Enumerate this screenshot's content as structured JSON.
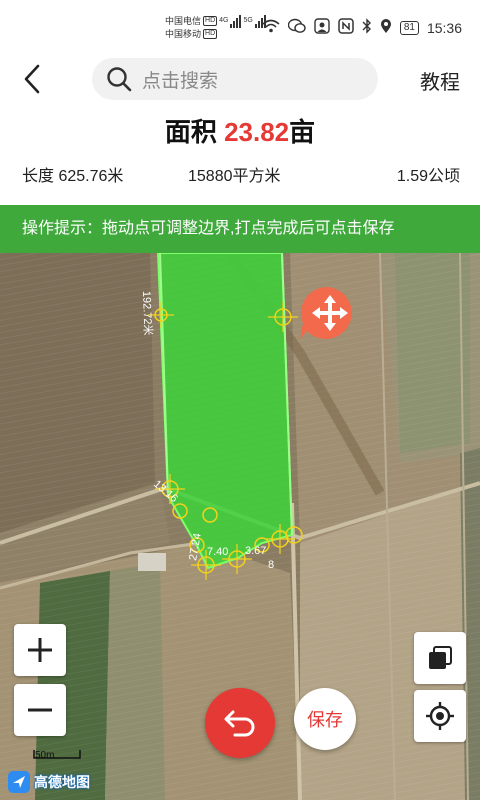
{
  "status_bar": {
    "carrier1": "中国电信",
    "carrier2": "中国移动",
    "hd": "HD",
    "net1": "4G",
    "net2": "5G",
    "battery": "81",
    "time": "15:36"
  },
  "header": {
    "search_placeholder": "点击搜索",
    "tutorial_label": "教程"
  },
  "area": {
    "prefix": "面积",
    "value": "23.82",
    "unit": "亩"
  },
  "stats": {
    "length": "长度 625.76米",
    "square_meters": "15880平方米",
    "hectares": "1.59公顷"
  },
  "tip": "操作提示：拖动点可调整边界,打点完成后可点击保存",
  "map": {
    "edge_labels": [
      "192.72米",
      "13.16",
      "27.24",
      "7.40",
      "3.67",
      "8"
    ],
    "scale_label": "50m",
    "logo_text": "高德地图"
  },
  "buttons": {
    "save": "保存"
  },
  "colors": {
    "accent_red": "#e53935",
    "tip_green": "#40a93c",
    "polygon_fill": "#3dd43a",
    "vertex_yellow": "#f2d21b"
  }
}
